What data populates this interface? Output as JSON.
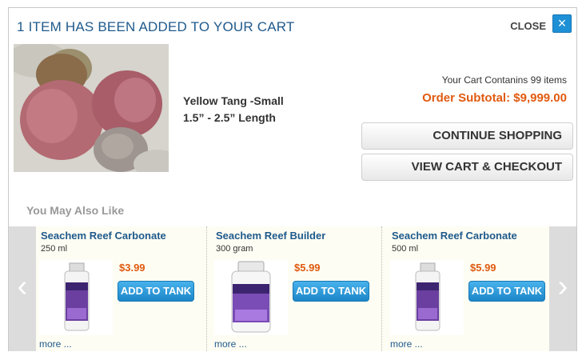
{
  "modal": {
    "title": "1 ITEM HAS BEEN ADDED TO YOUR CART",
    "close_label": "CLOSE",
    "close_icon": "×"
  },
  "product": {
    "name_line1": "Yellow Tang -Small",
    "name_line2": "1.5” - 2.5” Length"
  },
  "cart": {
    "count_text": "Your Cart Contanins 99 items",
    "subtotal_text": "Order Subtotal: $9,999.00",
    "continue_label": "CONTINUE SHOPPING",
    "checkout_label": "VIEW CART & CHECKOUT"
  },
  "recommendations": {
    "heading": "You May Also Like",
    "prev_icon": "‹",
    "next_icon": "›",
    "items": [
      {
        "name": "Seachem Reef Carbonate",
        "size": "250 ml",
        "price": "$3.99",
        "button": "ADD TO TANK",
        "more": "more ..."
      },
      {
        "name": "Seachem Reef Builder",
        "size": "300 gram",
        "price": "$5.99",
        "button": "ADD TO TANK",
        "more": "more ..."
      },
      {
        "name": "Seachem Reef Carbonate",
        "size": "500 ml",
        "price": "$5.99",
        "button": "ADD TO TANK",
        "more": "more ..."
      }
    ]
  },
  "colors": {
    "title_blue": "#1f5a8c",
    "accent_orange": "#e05a10",
    "button_blue": "#1e90d6"
  }
}
